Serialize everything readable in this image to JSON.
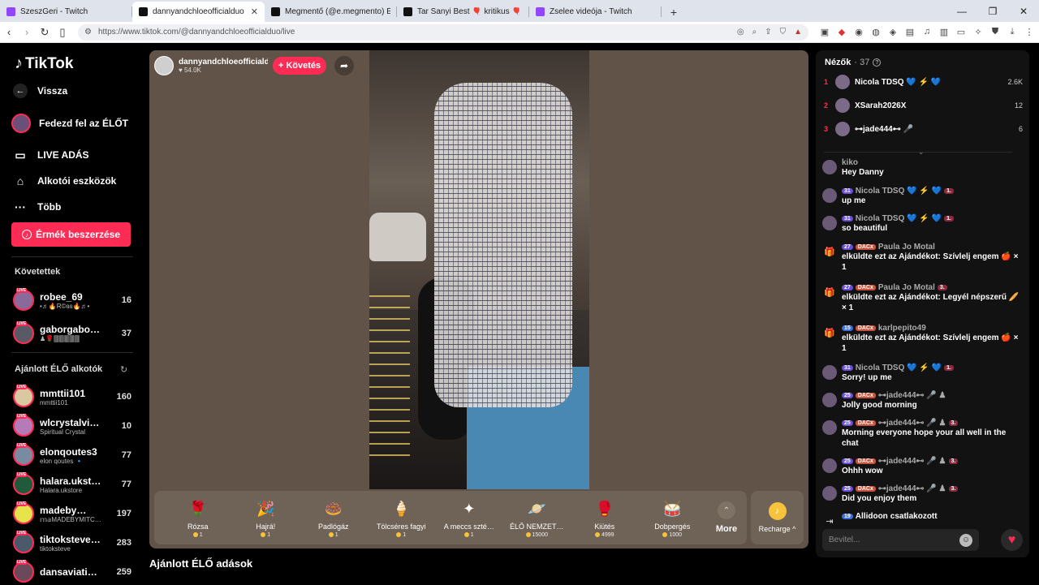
{
  "browser": {
    "tabs": [
      {
        "title": "SzeszGeri - Twitch",
        "color": "#9146ff",
        "active": false
      },
      {
        "title": "dannyandchloeofficialduo (@da…",
        "color": "#111111",
        "active": true
      },
      {
        "title": "Megmentő (@e.megmento) ÉLŐ adá…",
        "color": "#111111",
        "active": false
      },
      {
        "title": "Tar Sanyi Best 🎈 kritikus 🎈 (@szop…",
        "color": "#111111",
        "active": false
      },
      {
        "title": "Zselee videója - Twitch",
        "color": "#9146ff",
        "active": false
      }
    ],
    "url": "https://www.tiktok.com/@dannyandchloeofficialduo/live"
  },
  "sidebar": {
    "logo": "TikTok",
    "back": "Vissza",
    "nav": [
      {
        "label": "Fedezd fel az ÉLŐT",
        "icon": "avatar"
      },
      {
        "label": "LIVE ADÁS",
        "icon": "camera-icon"
      },
      {
        "label": "Alkotói eszközök",
        "icon": "creator-icon"
      },
      {
        "label": "Több",
        "icon": "more-icon"
      }
    ],
    "coins_button": "Érmék beszerzése",
    "following_title": "Követettek",
    "following": [
      {
        "name": "robee_69",
        "sub": "•♬🔥R©ɞɞ🔥♬•",
        "count": "16",
        "color": "#8a6a9a"
      },
      {
        "name": "gaborgabo…",
        "sub": "♟🌹🀫🀫🀫🀫🀫",
        "count": "37",
        "color": "#5a5a66"
      }
    ],
    "recommended_title": "Ajánlott ÉLŐ alkotók",
    "recommended": [
      {
        "name": "mmttii101",
        "sub": "mmttii101",
        "count": "160",
        "color": "#d9c8a0"
      },
      {
        "name": "wlcrystalvi…",
        "sub": "Spiritual Crystal",
        "count": "10",
        "color": "#b57ab8"
      },
      {
        "name": "elonqoutes3",
        "sub": "elon qoutes 🔹",
        "count": "77",
        "color": "#7a8aa0"
      },
      {
        "name": "halara.ukst…",
        "sub": "Halara.ukstore",
        "count": "77",
        "color": "#1f5b3a"
      },
      {
        "name": "madeby…",
        "sub": "𝕞𝕒MADEBYMITC…",
        "count": "197",
        "color": "#e7e34a"
      },
      {
        "name": "tiktoksteve…",
        "sub": "tiktoksteve",
        "count": "283",
        "color": "#4a5a6a"
      },
      {
        "name": "dansaviati…",
        "sub": "",
        "count": "259",
        "color": "#6a4a5a"
      }
    ]
  },
  "stream": {
    "host_name": "dannyandchloeofficiald…",
    "likes": "54.0K",
    "follow_label": "+ Követés",
    "gifts": [
      {
        "name": "Rózsa",
        "price": "1",
        "icon": "🌹"
      },
      {
        "name": "Hajrá!",
        "price": "1",
        "icon": "🎉"
      },
      {
        "name": "Padlógáz",
        "price": "1",
        "icon": "🍩"
      },
      {
        "name": "Tölcséres fagyi",
        "price": "1",
        "icon": "🍦"
      },
      {
        "name": "A meccs szté…",
        "price": "1",
        "icon": "✦"
      },
      {
        "name": "ÉLŐ NEMZET…",
        "price": "15000",
        "icon": "🪐"
      },
      {
        "name": "Kiütés",
        "price": "4999",
        "icon": "🥊"
      },
      {
        "name": "Dobpergés",
        "price": "1000",
        "icon": "🥁"
      }
    ],
    "more_label": "More",
    "recharge_label": "Recharge ^",
    "recommended_title": "Ajánlott ÉLŐ adások"
  },
  "panel": {
    "viewers_label": "Nézők",
    "viewers_count": "· 37",
    "ranking": [
      {
        "rank": "1",
        "name": "Nicola TDSQ 💙 ⚡ 💙",
        "value": "2.6K"
      },
      {
        "rank": "2",
        "name": "XSarah2026X",
        "value": "12"
      },
      {
        "rank": "3",
        "name": "⊶jade444⊷ 🎤",
        "value": "6"
      }
    ],
    "messages": [
      {
        "user": "kiko",
        "text": "Hey Danny",
        "level": "",
        "badge": "",
        "fan": "",
        "icon": "avatar"
      },
      {
        "user": "Nicola TDSQ 💙 ⚡ 💙",
        "text": "up me",
        "level": "31",
        "badge": "",
        "fan": "1.",
        "icon": "avatar"
      },
      {
        "user": "Nicola TDSQ 💙 ⚡ 💙",
        "text": "so beautiful",
        "level": "31",
        "badge": "",
        "fan": "1.",
        "icon": "avatar"
      },
      {
        "user": "Paula Jo Motal",
        "text": "elküldte ezt az Ajándékot: Szívlelj engem 🍎 × 1",
        "level": "27",
        "badge": "DACx",
        "fan": "",
        "icon": "gift"
      },
      {
        "user": "Paula Jo Motal",
        "text": "elküldte ezt az Ajándékot: Legyél népszerű 🥖 × 1",
        "level": "27",
        "badge": "DACx",
        "fan": "3.",
        "icon": "gift"
      },
      {
        "user": "karlpepito49",
        "text": "elküldte ezt az Ajándékot: Szívlelj engem 🍎 × 1",
        "level": "15",
        "badge": "DACx",
        "fan": "",
        "icon": "gift"
      },
      {
        "user": "Nicola TDSQ 💙 ⚡ 💙",
        "text": "Sorry! up me",
        "level": "31",
        "badge": "",
        "fan": "1.",
        "icon": "avatar"
      },
      {
        "user": "⊶jade444⊷ 🎤 ♟",
        "text": "Jolly good morning",
        "level": "25",
        "badge": "DACx",
        "fan": "",
        "icon": "avatar"
      },
      {
        "user": "⊶jade444⊷ 🎤 ♟",
        "text": "Morning everyone hope your all well in the chat",
        "level": "25",
        "badge": "DACx",
        "fan": "3.",
        "icon": "avatar"
      },
      {
        "user": "⊶jade444⊷ 🎤 ♟",
        "text": "Ohhh wow",
        "level": "25",
        "badge": "DACx",
        "fan": "3.",
        "icon": "avatar"
      },
      {
        "user": "⊶jade444⊷ 🎤 ♟",
        "text": "Did you enjoy them",
        "level": "25",
        "badge": "DACx",
        "fan": "3.",
        "icon": "avatar"
      },
      {
        "user": "Allidoon",
        "text": "csatlakozott",
        "level": "19",
        "badge": "",
        "fan": "",
        "icon": "join"
      }
    ],
    "input_placeholder": "Bevitel..."
  }
}
